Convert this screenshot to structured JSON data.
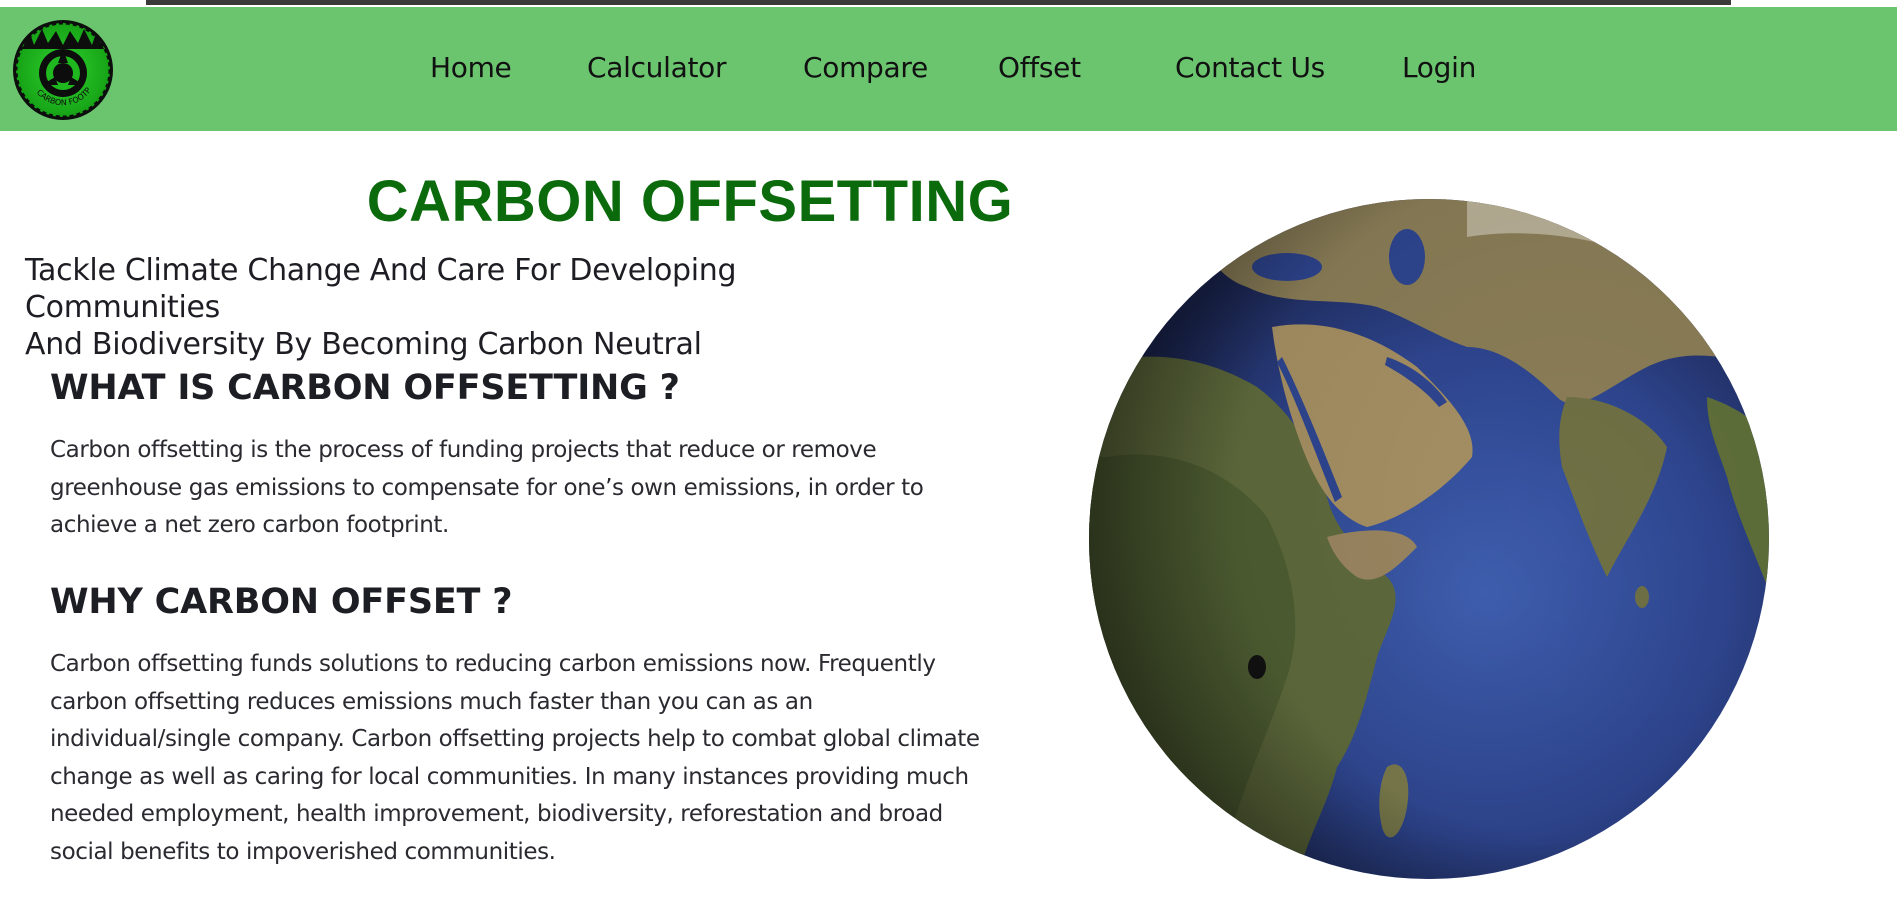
{
  "nav": {
    "logo_alt": "Carbon Footprint",
    "links": [
      "Home",
      "Calculator",
      "Compare",
      "Offset",
      "Contact Us",
      "Login"
    ]
  },
  "main": {
    "title": "CARBON OFFSETTING",
    "subtitle_line1": "Tackle Climate Change And Care For Developing Communities",
    "subtitle_line2": "And Biodiversity By Becoming Carbon Neutral",
    "sections": [
      {
        "heading": "WHAT IS CARBON OFFSETTING ?",
        "body": "Carbon offsetting is the process of funding projects that reduce or remove greenhouse gas emissions to compensate for one’s own emissions, in order to achieve a net zero carbon footprint."
      },
      {
        "heading": "WHY CARBON OFFSET ?",
        "body": "Carbon offsetting funds solutions to reducing carbon emissions now. Frequently carbon offsetting reduces emissions much faster than you can as an individual/single company. Carbon offsetting projects help to combat global climate change as well as caring for local communities. In many instances providing much needed employment, health improvement, biodiversity, reforestation and broad social benefits to impoverished communities."
      }
    ]
  },
  "colors": {
    "navbar": "#6bc56f",
    "title": "#0b6a0b",
    "text": "#1d1d24"
  },
  "icons": {
    "logo": "carbon-footprint-logo-icon",
    "globe": "earth-globe-image"
  }
}
